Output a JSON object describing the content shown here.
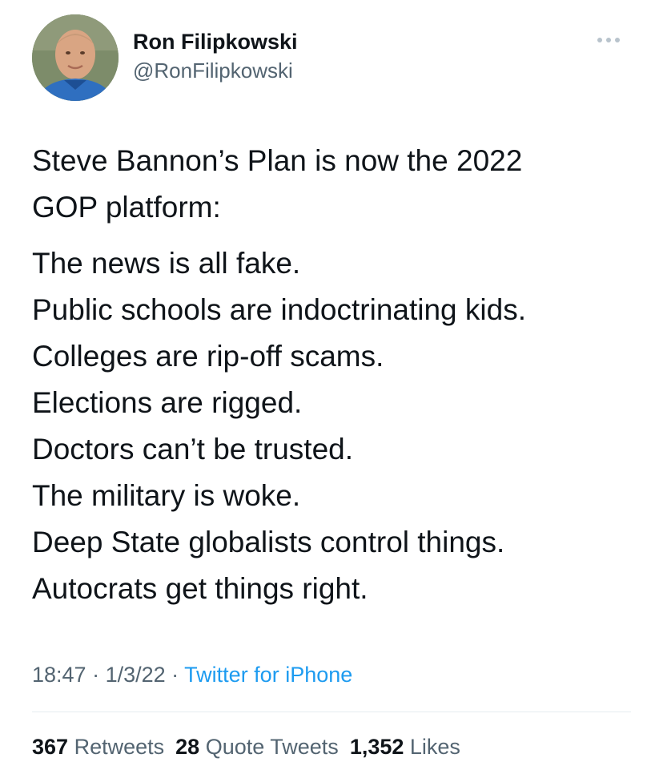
{
  "author": {
    "display_name": "Ron Filipkowski",
    "handle": "@RonFilipkowski",
    "avatar_icon": "profile-photo"
  },
  "more_icon": "more-dots-icon",
  "tweet": {
    "paragraphs": [
      [
        "Steve Bannon’s Plan is now the 2022",
        "GOP platform:"
      ],
      [
        "The news is all fake.",
        "Public schools are indoctrinating kids.",
        "Colleges are rip-off scams.",
        "Elections are rigged.",
        "Doctors can’t be trusted.",
        "The military is woke.",
        "Deep State globalists control things.",
        "Autocrats get things right."
      ]
    ]
  },
  "meta": {
    "time": "18:47",
    "date": "1/3/22",
    "separator": " · ",
    "source": "Twitter for iPhone"
  },
  "stats": {
    "retweets_count": "367",
    "retweets_label": "Retweets",
    "quotes_count": "28",
    "quotes_label": "Quote Tweets",
    "likes_count": "1,352",
    "likes_label": "Likes"
  },
  "colors": {
    "text": "#0f1419",
    "secondary": "#536471",
    "link": "#1d9bf0",
    "divider": "#e6ecf0"
  }
}
